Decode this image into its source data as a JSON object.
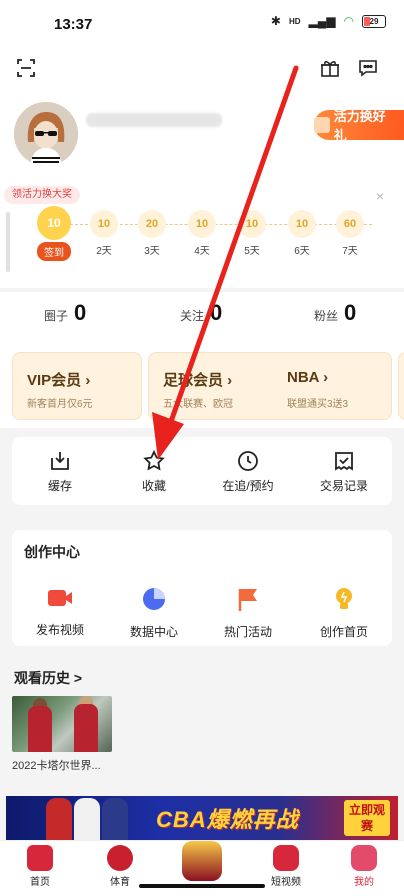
{
  "status_bar": {
    "time": "13:37",
    "battery": "29"
  },
  "header": {
    "activity_button": "活力换好礼",
    "promo_tag": "领活力换大奖",
    "close": "×"
  },
  "checkin": {
    "days": [
      {
        "coins": "10",
        "label": "签到",
        "today": true
      },
      {
        "coins": "10",
        "label": "2天"
      },
      {
        "coins": "20",
        "label": "3天"
      },
      {
        "coins": "10",
        "label": "4天"
      },
      {
        "coins": "10",
        "label": "5天"
      },
      {
        "coins": "10",
        "label": "6天"
      },
      {
        "coins": "60",
        "label": "7天"
      }
    ]
  },
  "stats": [
    {
      "label": "圈子",
      "value": "0"
    },
    {
      "label": "关注",
      "value": "0"
    },
    {
      "label": "粉丝",
      "value": "0"
    }
  ],
  "member_cards": [
    {
      "title": "VIP会员 ›",
      "subtitle": "新客首月仅6元"
    },
    {
      "title": "足球会员 ›",
      "subtitle": "五大联赛、欧冠"
    },
    {
      "title": "NBA ›",
      "subtitle": "联盟通买3送3"
    }
  ],
  "quick_actions": [
    {
      "label": "缓存",
      "icon": "download-icon"
    },
    {
      "label": "收藏",
      "icon": "star-icon"
    },
    {
      "label": "在追/预约",
      "icon": "clock-icon"
    },
    {
      "label": "交易记录",
      "icon": "receipt-icon"
    }
  ],
  "creation_center": {
    "title": "创作中心",
    "items": [
      {
        "label": "发布视频",
        "icon": "video-camera-icon",
        "color": "#ef4a3c"
      },
      {
        "label": "数据中心",
        "icon": "pie-chart-icon",
        "color": "#4b6cf0"
      },
      {
        "label": "热门活动",
        "icon": "flag-icon",
        "color": "#f26a3a"
      },
      {
        "label": "创作首页",
        "icon": "lightbulb-icon",
        "color": "#f7b828"
      }
    ]
  },
  "watch_history": {
    "title": "观看历史 >",
    "items": [
      {
        "caption": "2022卡塔尔世界..."
      }
    ]
  },
  "banner": {
    "title": "CBA爆燃再战",
    "cta": "立即观赛"
  },
  "tabs": [
    {
      "label": "首页",
      "icon": "home-icon"
    },
    {
      "label": "体育",
      "icon": "sports-icon"
    },
    {
      "label": "",
      "icon": "vip-trophy-icon"
    },
    {
      "label": "短视频",
      "icon": "short-video-icon"
    },
    {
      "label": "我的",
      "icon": "profile-icon",
      "active": true
    }
  ]
}
